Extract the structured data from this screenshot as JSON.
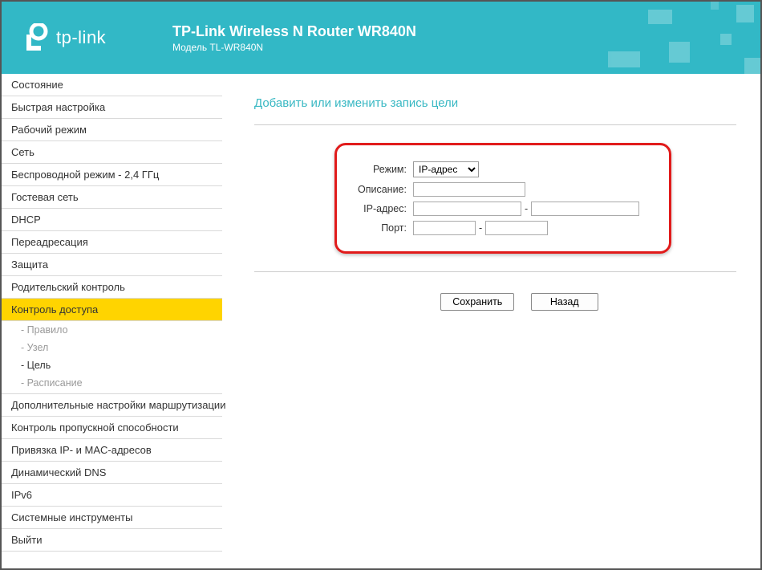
{
  "header": {
    "brand": "tp-link",
    "title": "TP-Link Wireless N Router WR840N",
    "subtitle": "Модель TL-WR840N"
  },
  "sidebar": {
    "items": [
      {
        "label": "Состояние",
        "type": "top"
      },
      {
        "label": "Быстрая настройка",
        "type": "top"
      },
      {
        "label": "Рабочий режим",
        "type": "top"
      },
      {
        "label": "Сеть",
        "type": "top"
      },
      {
        "label": "Беспроводной режим - 2,4 ГГц",
        "type": "top"
      },
      {
        "label": "Гостевая сеть",
        "type": "top"
      },
      {
        "label": "DHCP",
        "type": "top"
      },
      {
        "label": "Переадресация",
        "type": "top"
      },
      {
        "label": "Защита",
        "type": "top"
      },
      {
        "label": "Родительский контроль",
        "type": "top"
      },
      {
        "label": "Контроль доступа",
        "type": "top",
        "active": true
      },
      {
        "label": "- Правило",
        "type": "sub"
      },
      {
        "label": "- Узел",
        "type": "sub"
      },
      {
        "label": "- Цель",
        "type": "sub",
        "activeSub": true
      },
      {
        "label": "- Расписание",
        "type": "sub",
        "groupEnd": true
      },
      {
        "label": "Дополнительные настройки маршрутизации",
        "type": "top"
      },
      {
        "label": "Контроль пропускной способности",
        "type": "top"
      },
      {
        "label": "Привязка IP- и MAC-адресов",
        "type": "top"
      },
      {
        "label": "Динамический DNS",
        "type": "top"
      },
      {
        "label": "IPv6",
        "type": "top"
      },
      {
        "label": "Системные инструменты",
        "type": "top"
      },
      {
        "label": "Выйти",
        "type": "top"
      }
    ]
  },
  "main": {
    "page_title": "Добавить или изменить запись цели",
    "labels": {
      "mode": "Режим:",
      "description": "Описание:",
      "ip": "IP-адрес:",
      "port": "Порт:"
    },
    "mode_value": "IP-адрес",
    "mode_options": [
      "IP-адрес"
    ],
    "description_value": "",
    "ip_from": "",
    "ip_to": "",
    "port_from": "",
    "port_to": "",
    "save_label": "Сохранить",
    "back_label": "Назад"
  }
}
